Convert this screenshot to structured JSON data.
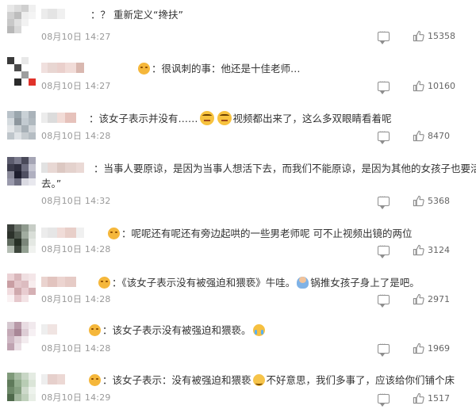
{
  "comments": [
    {
      "id": 1,
      "avatar": [
        "#e8e8e8",
        "#dcdcdc",
        "#cfcfcf",
        "#f0f0f0",
        "#d0d0d0",
        "#bdbdbd",
        "#eeeeee",
        "#f4f4f4",
        "#c8c8c8",
        "#e0e0e0",
        "#f2f2f2",
        "#ffffff",
        "#b8b8b8",
        "#d8d8d8",
        "#ffffff",
        "#ffffff"
      ],
      "name_blocks": [
        "#ececec",
        "#e4e4e4",
        "#f0f0f0"
      ],
      "text_before": "：？ 重新定义“搀扶”",
      "time": "08月10日 14:27",
      "likes": "15358"
    },
    {
      "id": 2,
      "avatar": [
        "#3a3a3a",
        "#ffffff",
        "#e8e8e8",
        "#ffffff",
        "#ffffff",
        "#4d4d4d",
        "#ffffff",
        "#ffffff",
        "#ffffff",
        "#ffffff",
        "#9e9e9e",
        "#ffffff",
        "#ffffff",
        "#2b2b2b",
        "#ffffff",
        "#e0322a"
      ],
      "name_blocks": [
        "#f0e0de",
        "#e8d6d2",
        "#ead0cc",
        "#f1dcd8",
        "#d9b8b0"
      ],
      "text_before": "很讽刺的事：他还是十佳老师…",
      "time": "08月10日 14:27",
      "likes": "10160"
    },
    {
      "id": 3,
      "avatar": [
        "#b9c2c9",
        "#9aa6ad",
        "#c9d1d6",
        "#aab3ba",
        "#d5dbdf",
        "#8e979e",
        "#c2cad0",
        "#b0b9bf",
        "#e3e6e8",
        "#c8ced2",
        "#a7b0b6",
        "#d2d7db",
        "#bfc6cb",
        "#dfe3e6",
        "#c6ccd0",
        "#b5bdc3"
      ],
      "name_blocks": [
        "#ececec",
        "#dcdcdc",
        "#f2dcd7",
        "#e6c2bb"
      ],
      "text_before": "：该女子表示并没有……",
      "text_after": "视频都出来了，这么多双眼睛看着呢",
      "time": "08月10日 14:28",
      "likes": "8470"
    },
    {
      "id": 4,
      "avatar": [
        "#5c5c6e",
        "#7a7a8c",
        "#4a4a5a",
        "#a5a5b5",
        "#3c3c4c",
        "#2e2e3e",
        "#6e6e80",
        "#c4c4d0",
        "#8a8a9a",
        "#1e1e2e",
        "#505062",
        "#b0b0c0",
        "#9a9aac",
        "#707082",
        "#dadae2",
        "#e8e8ee"
      ],
      "name_blocks": [
        "#e2e2e2",
        "#e8d8d4",
        "#dcc8c2",
        "#e4d2cd",
        "#ead9d5"
      ],
      "text_line1": "：当事人要原谅，是因为当事人想活下去，而我们不能原谅，是因为其他的女孩子也要活下",
      "text_line2": "去。”",
      "time": "08月10日 14:32",
      "likes": "5368"
    },
    {
      "id": 5,
      "avatar": [
        "#3a3f3a",
        "#6d756c",
        "#8f9a8e",
        "#c7cdc6",
        "#2c322b",
        "#4f584e",
        "#a1aca0",
        "#d9ded8",
        "#5f6a5e",
        "#273026",
        "#7b867a",
        "#e4e8e3",
        "#b5beb4",
        "#3e473d",
        "#93a092",
        "#f0f2ef"
      ],
      "name_blocks": [
        "#ececec",
        "#e6e6e6",
        "#f0dcd8",
        "#e8cfc9",
        "#f0f0f0"
      ],
      "text_before": "呢呢还有呢还有旁边起哄的一些男老师呢 可不止视频出镜的两位",
      "time": "08月10日 14:28",
      "likes": "3124"
    },
    {
      "id": 6,
      "avatar": [
        "#ebd2d5",
        "#d9b7bb",
        "#efdfe1",
        "#f4e6e8",
        "#c99ea3",
        "#e3c5c9",
        "#dcbcc0",
        "#f7edee",
        "#f1dcdf",
        "#cfa9ad",
        "#e8ccd0",
        "#d5b0b4",
        "#faf2f3",
        "#e6c8cc",
        "#f3e3e5",
        "#ffffff"
      ],
      "name_blocks": [
        "#ead3cf",
        "#e2c4bf",
        "#ecd4d0",
        "#e6cbc6"
      ],
      "text_before": "：《该女子表示没有被强迫和猥亵》牛哇。",
      "text_after": "锅推女孩子身上了是吧。",
      "time": "08月10日 14:28",
      "likes": "2971"
    },
    {
      "id": 7,
      "avatar": [
        "#d6c8d0",
        "#b89aa8",
        "#e8dce2",
        "#f1e9ed",
        "#c4a9b6",
        "#a98797",
        "#ddcdd5",
        "#f6f0f3",
        "#cdb6c2",
        "#e2d3da",
        "#f3ecef",
        "#ffffff",
        "#bfa3b1",
        "#eadfe5",
        "#ffffff",
        "#ffffff"
      ],
      "name_blocks": [
        "#eeeeee",
        "#f0e4e2"
      ],
      "text_before": "该女子表示没有被强迫和猥亵。",
      "time": "08月10日 14:28",
      "likes": "1969"
    },
    {
      "id": 8,
      "avatar": [
        "#7f9a7a",
        "#a7bca3",
        "#c8d6c5",
        "#e4ebe2",
        "#5f7a5a",
        "#93ad8e",
        "#b8ccb4",
        "#dbe5d8",
        "#6d8868",
        "#86a081",
        "#cdd9ca",
        "#eef3ed",
        "#4f6a4b",
        "#a1b69c",
        "#bfd0bb",
        "#e8eee6"
      ],
      "name_blocks": [
        "#eeeeee",
        "#e6d0cc",
        "#ecd8d4"
      ],
      "text_before": "：该女子表示：没有被强迫和猥亵",
      "text_after": "不好意思，我们多事了，应该给你们铺个床",
      "time": "08月10日 14:29",
      "likes": "1517"
    }
  ],
  "icons": {
    "reply": "reply-icon",
    "like": "thumbs-up-icon"
  }
}
